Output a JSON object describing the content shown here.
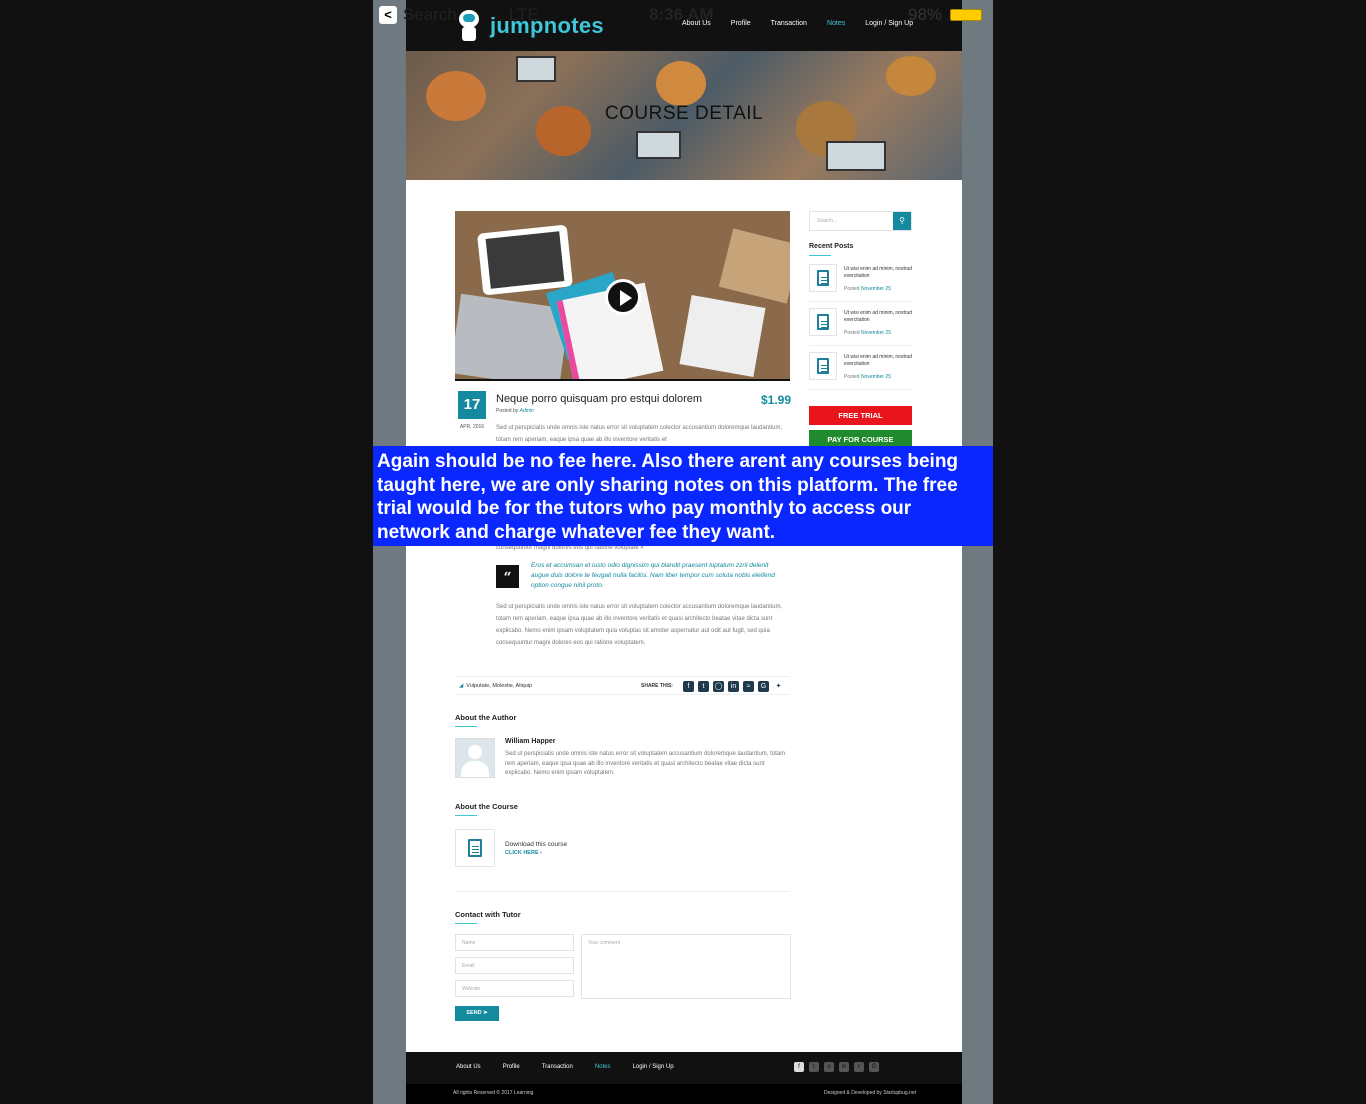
{
  "status_bar": {
    "back_glyph": "<",
    "carrier": "Search",
    "signal": "LTE",
    "time": "8:36 AM",
    "battery": "98%"
  },
  "nav": {
    "logo_text": "jumpnotes",
    "links": [
      "About Us",
      "Profile",
      "Transaction",
      "Notes",
      "Login / Sign Up"
    ],
    "active": "Notes"
  },
  "hero": {
    "title": "COURSE DETAIL"
  },
  "post": {
    "day": "17",
    "month_year": "APR, 2016",
    "title": "Neque porro quisquam pro estqui dolorem",
    "price": "$1.99",
    "posted_by_label": "Posted by",
    "author_link": "Admin",
    "para1": "Sed ut perspiciatis unde omnis iste natus error sit voluptatem colector accusantium doloremque laudantium, totam rem aperiam, eaque ipsa quae ab illo inventore veritatis et",
    "para1_tail": "consequuntur magni dolores eos qui ratione voluptate «",
    "quote": "Eros et accumsan et iusto odio dignissim qui blandit praesent luptatum zzril delenit augue duis dolore te feugait nulla facilisi. Nam liber tempor cum soluta nobis eleifend option congue nihil proto.",
    "para2": "Sed ut perspiciatis unde omnis iste natus error sit voluptatem colector accusantium doloremque laudantium, totam rem aperiam, eaque ipsa quae ab illo inventore veritatis et quasi architecto beatae vitae dicta sunt explicabo. Nemo enim ipsam voluptatem quia voluptas sit amoter aspernatur aut odit aut fugit, sed quia consequuntur magni dolores eos qui ratione voluptatem.",
    "tags": "Vulputate,  Molestie,  Aliquip",
    "share_label": "SHARE THIS:"
  },
  "author": {
    "heading": "About the Author",
    "name": "William Happer",
    "bio": "Sed ut perspiciatis unde omnis iste natus error sit voluptatem accusantium doloremque laudantium, totam rem aperiam, eaque ipsa quae ab illo inventore veritatis et quasi architecto beatae vitae dicta sunt explicabo. Nemo enim ipsam voluptatem."
  },
  "course": {
    "heading": "About the Course",
    "download_text": "Download this course",
    "download_link": "CLICK HERE ›"
  },
  "contact": {
    "heading": "Contact with Tutor",
    "name_placeholder": "Name",
    "email_placeholder": "Email",
    "website_placeholder": "Website",
    "comment_placeholder": "Your comment",
    "send_label": "SEND"
  },
  "sidebar": {
    "search_placeholder": "Search...",
    "recent_heading": "Recent Posts",
    "recent_posts": [
      {
        "title": "Ut wisi enim ad minim, nostrud exercitation",
        "posted": "Posted",
        "date": "November 25"
      },
      {
        "title": "Ut wisi enim ad minim, nostrud exercitation",
        "posted": "Posted",
        "date": "November 25"
      },
      {
        "title": "Ut wisi enim ad minim, nostrud exercitation",
        "posted": "Posted",
        "date": "November 25"
      }
    ],
    "free_trial": "FREE TRIAL",
    "pay": "PAY FOR COURSE"
  },
  "footer": {
    "links": [
      "About Us",
      "Profile",
      "Transaction",
      "Notes",
      "Login / Sign Up"
    ],
    "copyright": "All rights Reserved © 2017 Learning",
    "credit": "Designed & Developed by Startupbug.net"
  },
  "annotation": "Again should be no fee here. Also there arent any courses being taught here, we are only sharing notes on this platform. The free trial would be for the tutors who pay monthly to access our network and charge whatever fee they want.",
  "colors": {
    "accent": "#138a9e",
    "annotation_bg": "#0a27ff",
    "trial_red": "#e8161c",
    "pay_green": "#1f8a2e"
  }
}
